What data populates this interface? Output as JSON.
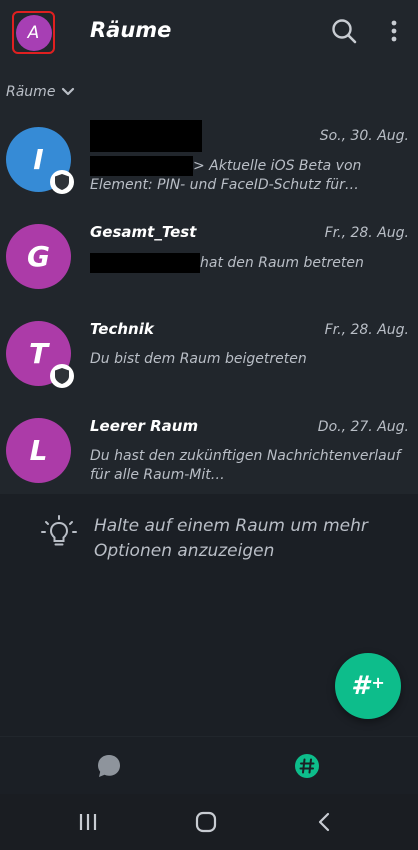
{
  "header": {
    "avatar_letter": "A",
    "title": "Räume",
    "search_icon": "search-icon",
    "menu_icon": "more-vertical-icon"
  },
  "section": {
    "label": "Räume",
    "chevron_icon": "chevron-down-icon"
  },
  "rooms": [
    {
      "letter": "I",
      "name": "",
      "date": "So., 30. Aug.",
      "preview_prefix": "",
      "preview": "> Aktuelle iOS Beta von Element: PIN- und FaceID-Schutz für…",
      "color": "#368bd6",
      "encrypted": true
    },
    {
      "letter": "G",
      "name": "Gesamt_Test",
      "date": "Fr., 28. Aug.",
      "preview": "hat den Raum betreten",
      "color": "#ac3ba8",
      "encrypted": false
    },
    {
      "letter": "T",
      "name": "Technik",
      "date": "Fr., 28. Aug.",
      "preview": "Du bist dem Raum beigetreten",
      "color": "#ac3ba8",
      "encrypted": true
    },
    {
      "letter": "L",
      "name": "Leerer Raum",
      "date": "Do., 27. Aug.",
      "preview": "Du hast den zukünftigen Nachrichtenverlauf für alle Raum-Mit…",
      "color": "#ac3ba8",
      "encrypted": false
    }
  ],
  "hint": {
    "text": "Halte auf einem Raum um mehr Optionen anzuzeigen",
    "icon": "lightbulb-icon"
  },
  "fab": {
    "label": "#",
    "plus": "+",
    "color": "#0dbd8b"
  },
  "bottom_nav": {
    "tabs": [
      {
        "icon": "chat-bubble-icon",
        "active": false
      },
      {
        "icon": "rooms-hash-icon",
        "active": true
      }
    ]
  },
  "system_nav": {
    "recents_icon": "recents-icon",
    "home_icon": "home-icon",
    "back_icon": "back-icon"
  }
}
